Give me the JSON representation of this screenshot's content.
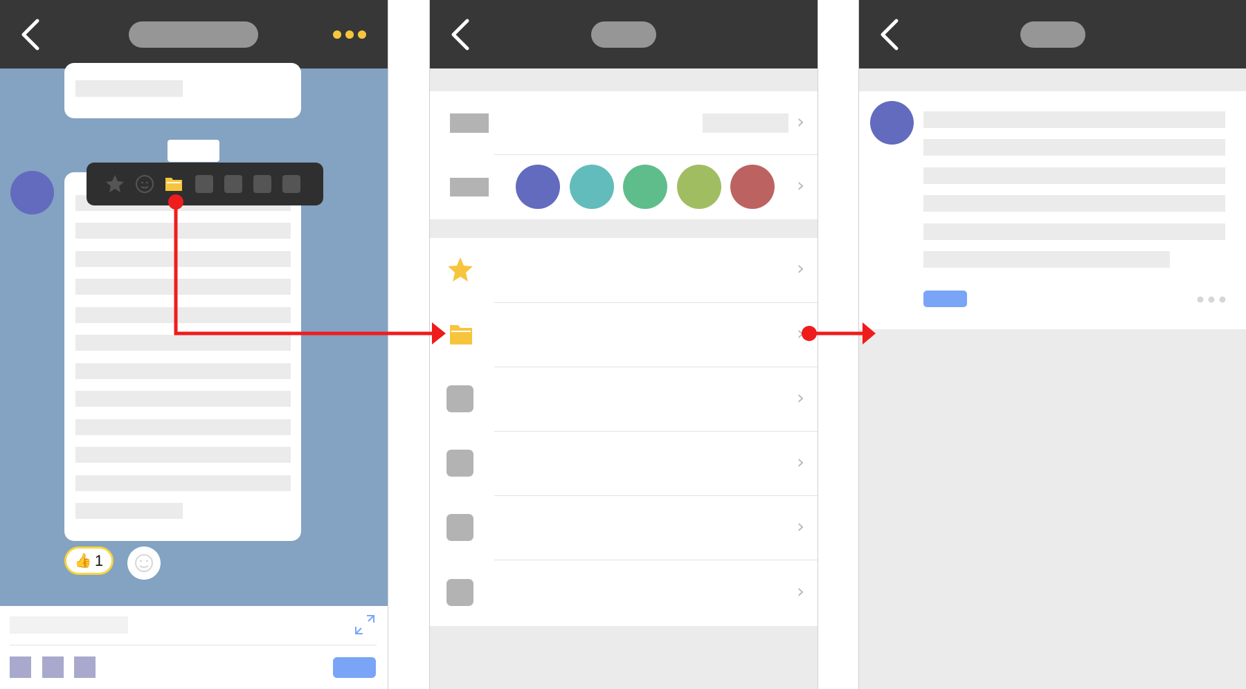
{
  "colors": {
    "header_bg": "#373737",
    "chat_bg": "#84a2c2",
    "accent_yellow": "#f7c53d",
    "accent_blue": "#7aa5f7",
    "avatar": "#626bbd",
    "arrow_red": "#ef1c1c"
  },
  "icons": {
    "back": "chevron-left-icon",
    "more": "more-dots-icon",
    "star": "star-icon",
    "folder": "folder-icon",
    "emoji": "emoji-icon",
    "expand": "expand-icon",
    "chevron": "chevron-right-icon",
    "thumbs_up": "thumbs-up-icon"
  },
  "screen1": {
    "reaction": {
      "emoji": "👍",
      "count": "1"
    },
    "toolbar_items": [
      "star-icon",
      "emoji-icon",
      "folder-icon",
      "blank",
      "blank",
      "blank",
      "blank"
    ]
  },
  "screen2": {
    "chevron_glyph": "›",
    "label_colors": [
      "#626bbd",
      "#62bcbb",
      "#5fbd8b",
      "#a1bd62",
      "#bc6361"
    ]
  },
  "screen3": {}
}
